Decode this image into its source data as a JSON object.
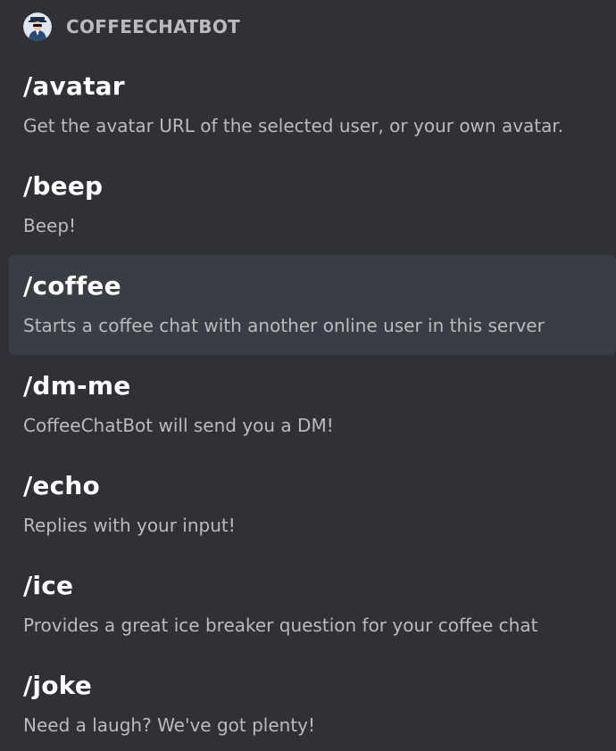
{
  "bot": {
    "name": "COFFEECHATBOT",
    "avatar_icon": "bot-avatar-icon"
  },
  "commands": [
    {
      "name": "/avatar",
      "description": "Get the avatar URL of the selected user, or your own avatar.",
      "selected": false
    },
    {
      "name": "/beep",
      "description": "Beep!",
      "selected": false
    },
    {
      "name": "/coffee",
      "description": "Starts a coffee chat with another online user in this server",
      "selected": true
    },
    {
      "name": "/dm-me",
      "description": "CoffeeChatBot will send you a DM!",
      "selected": false
    },
    {
      "name": "/echo",
      "description": "Replies with your input!",
      "selected": false
    },
    {
      "name": "/ice",
      "description": "Provides a great ice breaker question for your coffee chat",
      "selected": false
    },
    {
      "name": "/joke",
      "description": "Need a laugh? We've got plenty!",
      "selected": false
    }
  ],
  "colors": {
    "background": "#2f3136",
    "selected_background": "#3b3d44",
    "command_text": "#ffffff",
    "description_text": "#b9bbbe",
    "header_text": "#b9bbbe"
  }
}
